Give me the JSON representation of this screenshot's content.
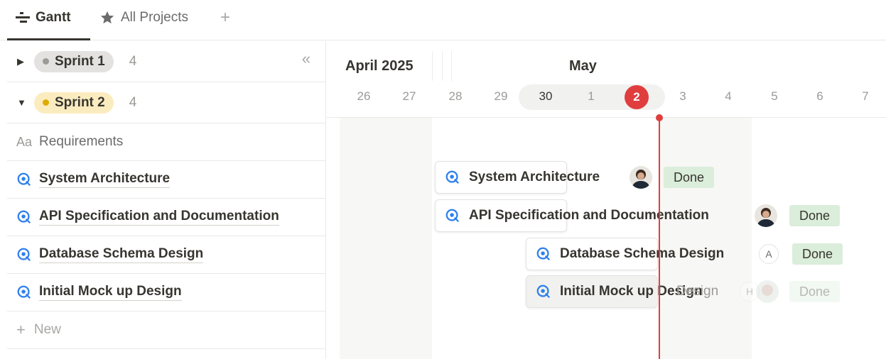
{
  "tabs": [
    {
      "label": "Gantt",
      "icon": "gantt-icon"
    },
    {
      "label": "All Projects",
      "icon": "star-icon"
    }
  ],
  "add_tab": "+",
  "groups": [
    {
      "label": "Sprint 1",
      "count": "4",
      "expanded": false,
      "color": "#9b9a97",
      "bg": "#e3e2e0"
    },
    {
      "label": "Sprint 2",
      "count": "4",
      "expanded": true,
      "color": "#dfab01",
      "bg": "#fbecc0"
    }
  ],
  "collapse_glyph": "«",
  "column_header": {
    "prefix": "Aa",
    "label": "Requirements"
  },
  "tasks": [
    {
      "label": "System Architecture",
      "status": "Done",
      "assignee": "photo"
    },
    {
      "label": "API Specification and Documentation",
      "status": "Done",
      "assignee": "photo"
    },
    {
      "label": "Database Schema Design",
      "status": "Done",
      "assignee": "A"
    },
    {
      "label": "Initial Mock up Design",
      "status": "Done",
      "assignee": "H"
    }
  ],
  "new_label": "New",
  "timeline": {
    "months": [
      "April 2025",
      "May"
    ],
    "days": [
      "26",
      "27",
      "28",
      "29",
      "30",
      "1",
      "2",
      "3",
      "4",
      "5",
      "6",
      "7"
    ],
    "today": "2",
    "ghost_label": "Design"
  },
  "colors": {
    "today": "#e03e3e",
    "done_bg": "#dbeddb",
    "task_icon": "#2f80ed"
  }
}
